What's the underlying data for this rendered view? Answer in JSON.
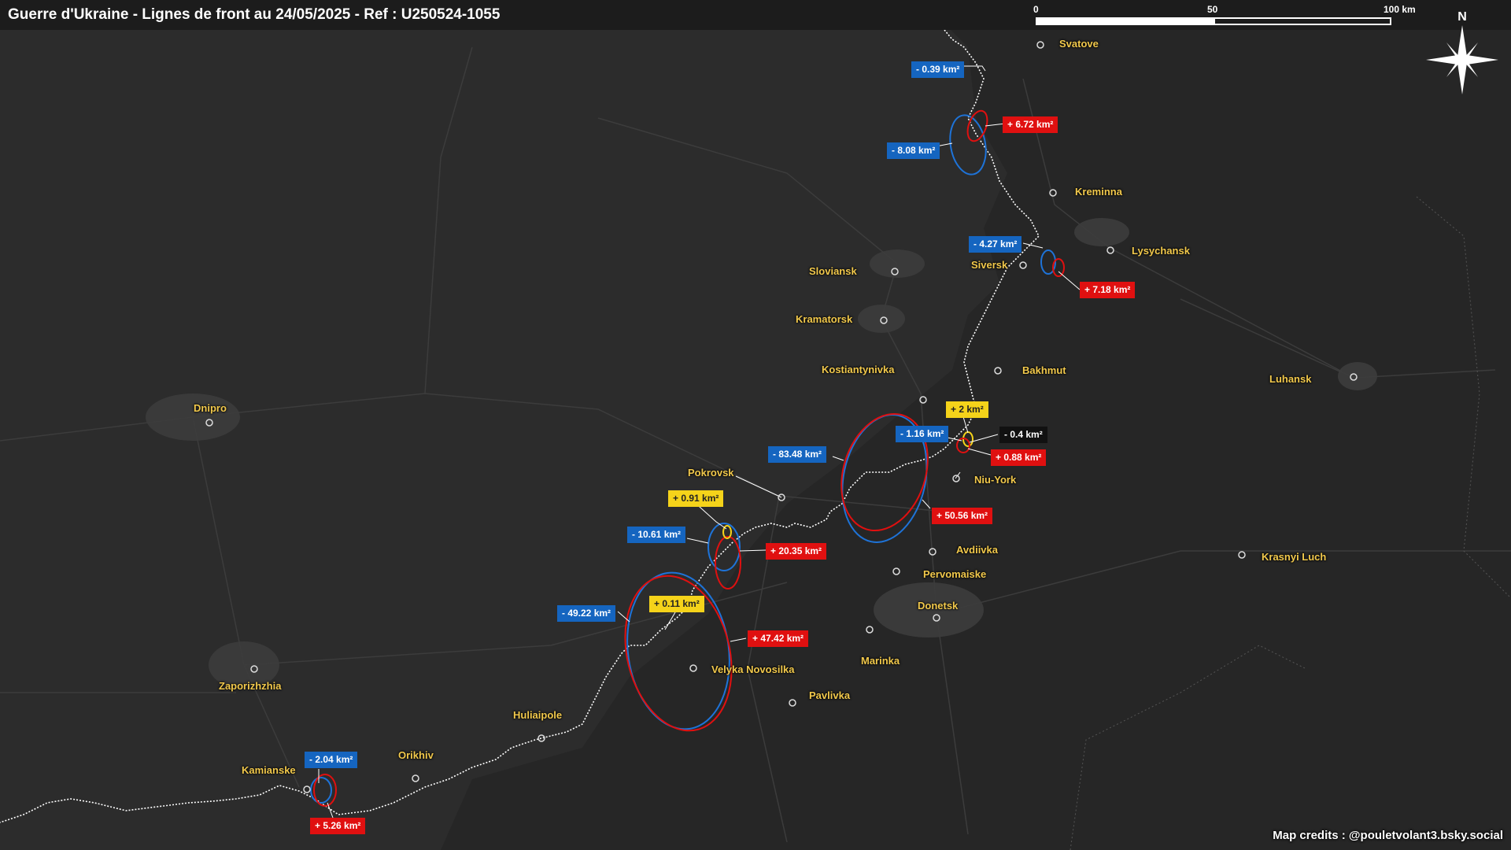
{
  "title": "Guerre d'Ukraine - Lignes de front au 24/05/2025 - Ref : U250524-1055",
  "scale_bar": {
    "labels": [
      "0",
      "50",
      "100 km"
    ]
  },
  "north_arrow": {
    "label": "N",
    "icon": "compass-star-icon"
  },
  "credits": "Map credits : @pouletvolant3.bsky.social",
  "colors": {
    "background": "#2c2c2c",
    "gain_red": "#e01010",
    "loss_blue": "#1565c0",
    "neutral_yellow": "#f5d31a",
    "city_label": "#f2c94c",
    "frontline": "#ffffff"
  },
  "cities": [
    "Svatove",
    "Kreminna",
    "Lysychansk",
    "Siversk",
    "Sloviansk",
    "Kramatorsk",
    "Kostiantynivka",
    "Bakhmut",
    "Luhansk",
    "Dnipro",
    "Pokrovsk",
    "Niu-York",
    "Avdiivka",
    "Pervomaiske",
    "Donetsk",
    "Marinka",
    "Krasnyi Luch",
    "Velyka Novosilka",
    "Pavlivka",
    "Zaporizhzhia",
    "Huliaipole",
    "Orikhiv",
    "Kamianske"
  ],
  "badges": [
    {
      "text": "- 0.39 km²",
      "type": "blue"
    },
    {
      "text": "+ 6.72 km²",
      "type": "red"
    },
    {
      "text": "- 8.08 km²",
      "type": "blue"
    },
    {
      "text": "- 4.27 km²",
      "type": "blue"
    },
    {
      "text": "+ 7.18 km²",
      "type": "red"
    },
    {
      "text": "+ 2 km²",
      "type": "yellow"
    },
    {
      "text": "- 1.16 km²",
      "type": "blue"
    },
    {
      "text": "- 0.4 km²",
      "type": "black"
    },
    {
      "text": "+ 0.88 km²",
      "type": "red"
    },
    {
      "text": "- 83.48 km²",
      "type": "blue"
    },
    {
      "text": "+ 50.56 km²",
      "type": "red"
    },
    {
      "text": "+ 0.91 km²",
      "type": "yellow"
    },
    {
      "text": "- 10.61 km²",
      "type": "blue"
    },
    {
      "text": "+ 20.35 km²",
      "type": "red"
    },
    {
      "text": "- 49.22 km²",
      "type": "blue"
    },
    {
      "text": "+ 0.11 km²",
      "type": "yellow"
    },
    {
      "text": "+ 47.42 km²",
      "type": "red"
    },
    {
      "text": "- 2.04 km²",
      "type": "blue"
    },
    {
      "text": "+ 5.26 km²",
      "type": "red"
    }
  ]
}
